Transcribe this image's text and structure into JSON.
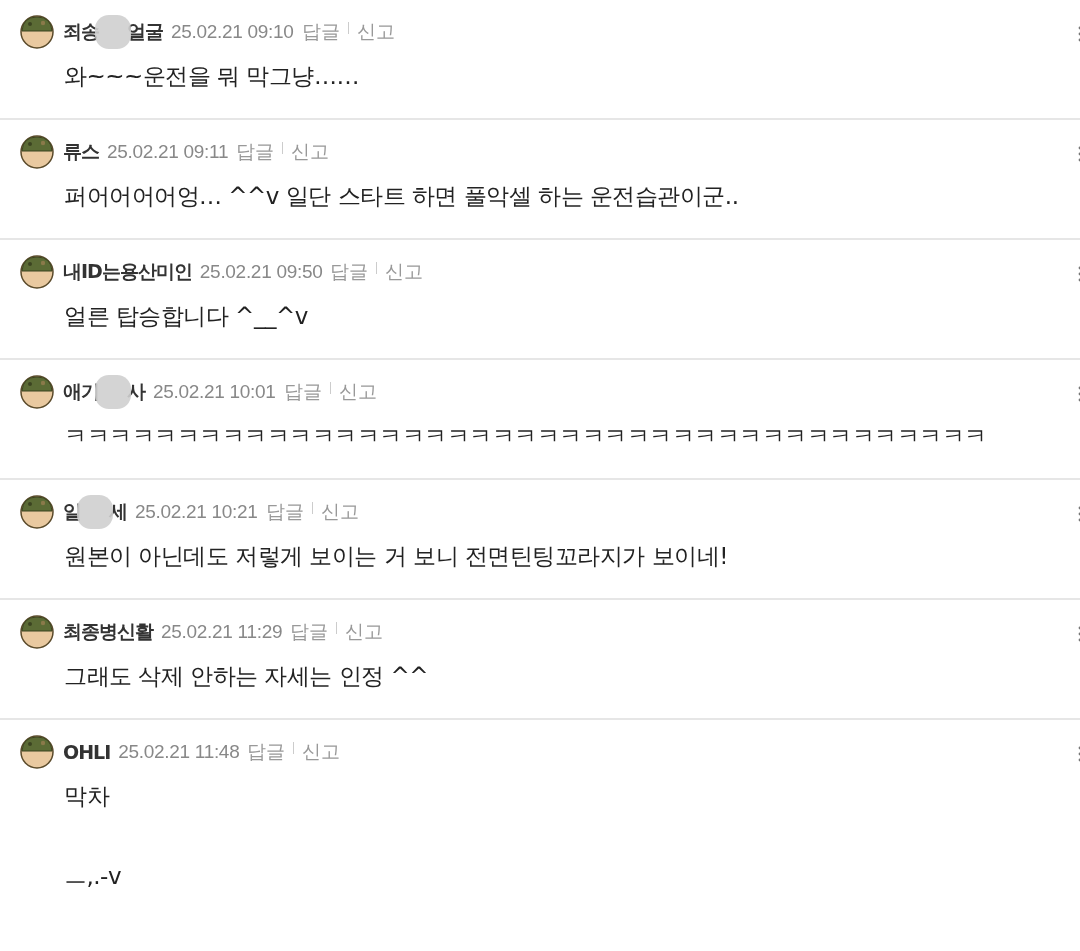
{
  "comments": [
    {
      "name": [
        "죄송",
        "얼굴"
      ],
      "blurred": true,
      "date": "25.02.21 09:10",
      "reply": "답글",
      "report": "신고",
      "body": "와~~~운전을 뭐 막그냥……"
    },
    {
      "name": [
        "류스"
      ],
      "blurred": false,
      "date": "25.02.21 09:11",
      "reply": "답글",
      "report": "신고",
      "body": "퍼어어어어엉… ^^v 일단 스타트 하면 풀악셀 하는 운전습관이군.."
    },
    {
      "name": [
        "내ID는용산미인"
      ],
      "blurred": false,
      "date": "25.02.21 09:50",
      "reply": "답글",
      "report": "신고",
      "body": "얼른 탑승합니다 ^__^v"
    },
    {
      "name": [
        "애기",
        "사"
      ],
      "blurred": true,
      "date": "25.02.21 10:01",
      "reply": "답글",
      "report": "신고",
      "body": "ㅋㅋㅋㅋㅋㅋㅋㅋㅋㅋㅋㅋㅋㅋㅋㅋㅋㅋㅋㅋㅋㅋㅋㅋㅋㅋㅋㅋㅋㅋㅋㅋㅋㅋㅋㅋㅋㅋㅋㅋㅋ"
    },
    {
      "name": [
        "일",
        "세"
      ],
      "blurred": true,
      "date": "25.02.21 10:21",
      "reply": "답글",
      "report": "신고",
      "body": "원본이 아닌데도 저렇게 보이는 거 보니 전면틴팅꼬라지가 보이네!"
    },
    {
      "name": [
        "최종병신활"
      ],
      "blurred": false,
      "date": "25.02.21 11:29",
      "reply": "답글",
      "report": "신고",
      "body": "그래도 삭제 안하는 자세는 인정 ^^"
    },
    {
      "name": [
        "OHLI"
      ],
      "blurred": false,
      "date": "25.02.21 11:48",
      "reply": "답글",
      "report": "신고",
      "body": "막차\n\nㅡ,.-v"
    }
  ]
}
